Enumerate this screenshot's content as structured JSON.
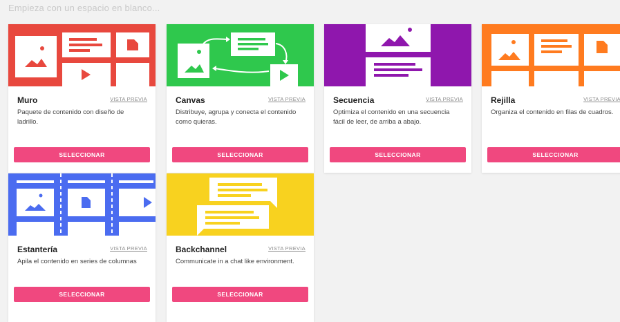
{
  "intro_text": "Empieza con un espacio en blanco...",
  "colors": {
    "muro": "#e8483e",
    "canvas": "#2fc84d",
    "secuencia": "#8f17ad",
    "rejilla": "#ff7b1f",
    "estanteria": "#4b6cf0",
    "backchannel": "#f8d21f",
    "button": "#f0487f"
  },
  "cards": [
    {
      "title": "Muro",
      "preview": "VISTA PREVIA",
      "description": "Paquete de contenido con diseño de ladrillo.",
      "button": "SELECCIONAR",
      "icon": "wall-layout-illustration"
    },
    {
      "title": "Canvas",
      "preview": "VISTA PREVIA",
      "description": "Distribuye, agrupa y conecta el contenido como quieras.",
      "button": "SELECCIONAR",
      "icon": "canvas-layout-illustration"
    },
    {
      "title": "Secuencia",
      "preview": "VISTA PREVIA",
      "description": "Optimiza el contenido en una secuencia fácil de leer, de arriba a abajo.",
      "button": "SELECCIONAR",
      "icon": "stream-layout-illustration"
    },
    {
      "title": "Rejilla",
      "preview": "VISTA PREVIA",
      "description": "Organiza el contenido en filas de cuadros.",
      "button": "SELECCIONAR",
      "icon": "grid-layout-illustration"
    },
    {
      "title": "Estantería",
      "preview": "VISTA PREVIA",
      "description": "Apila el contenido en series de columnas",
      "button": "SELECCIONAR",
      "icon": "shelf-layout-illustration"
    },
    {
      "title": "Backchannel",
      "preview": "VISTA PREVIA",
      "description": "Communicate in a chat like environment.",
      "button": "SELECCIONAR",
      "icon": "chat-layout-illustration"
    }
  ]
}
